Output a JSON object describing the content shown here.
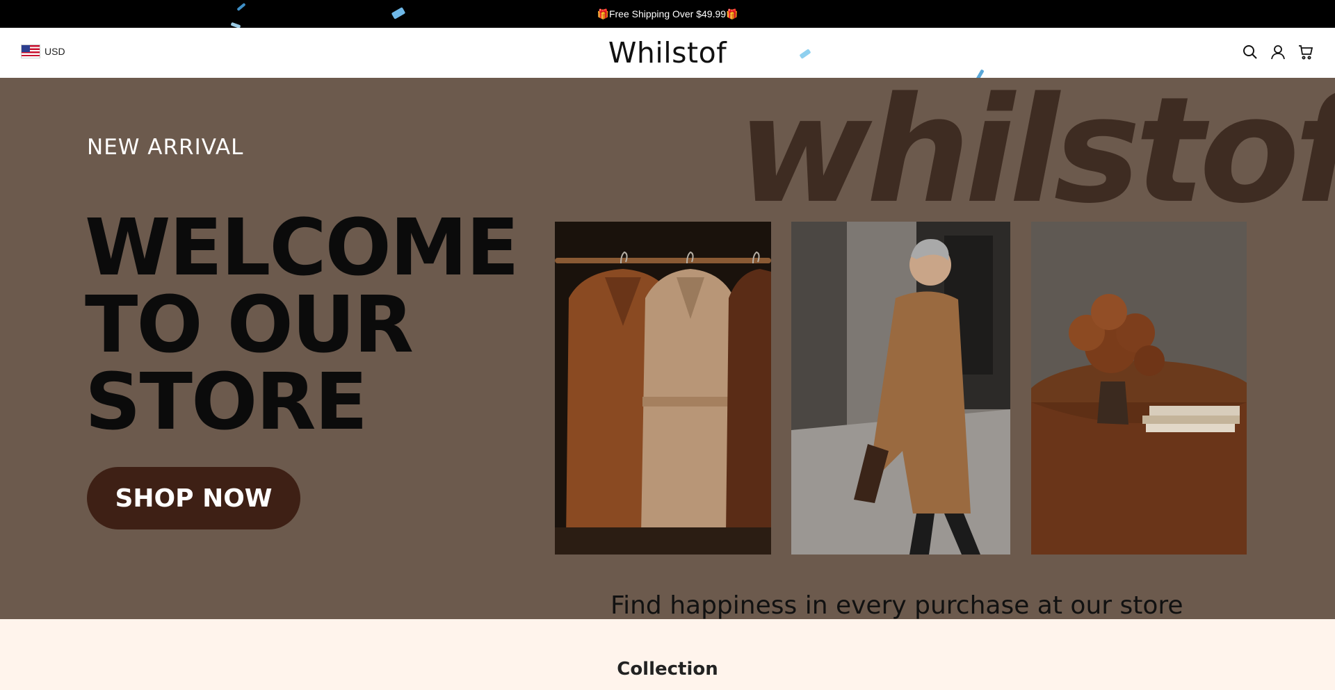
{
  "announcement": {
    "text": "🎁Free Shipping Over $49.99🎁"
  },
  "header": {
    "currency": "USD",
    "currency_flag": "us-flag-icon",
    "logo": "Whilstof",
    "icons": [
      "search-icon",
      "account-icon",
      "cart-icon"
    ]
  },
  "hero": {
    "background_word": "whilstof",
    "eyebrow": "NEW ARRIVAL",
    "headline_lines": [
      "WELCOME",
      "TO OUR",
      "STORE"
    ],
    "cta_label": "SHOP NOW",
    "tagline": "Find happiness in every purchase at our store",
    "colors": {
      "background": "#6c5a4d",
      "cta": "#3e2015",
      "word": "#3e2c22"
    }
  },
  "collection": {
    "title": "Collection",
    "background": "#fff4ec"
  }
}
